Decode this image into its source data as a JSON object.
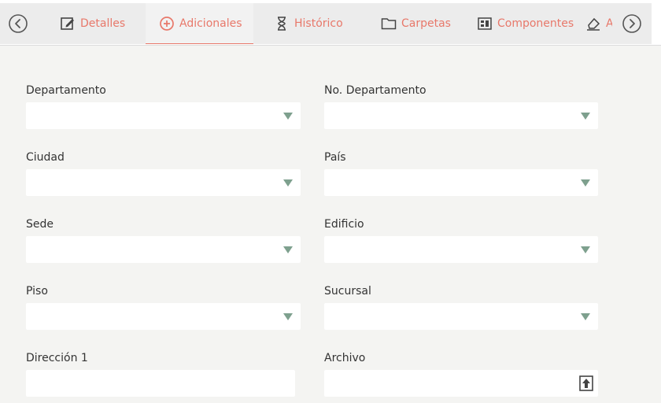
{
  "tabs": [
    {
      "label": "Detalles",
      "icon": "edit-icon"
    },
    {
      "label": "Adicionales",
      "icon": "plus-circle-icon"
    },
    {
      "label": "Histórico",
      "icon": "hourglass-icon"
    },
    {
      "label": "Carpetas",
      "icon": "folder-icon"
    },
    {
      "label": "Componentes",
      "icon": "components-icon"
    },
    {
      "label": "A",
      "icon": "eraser-icon"
    }
  ],
  "active_tab": "Adicionales",
  "colors": {
    "accent": "#e8786a",
    "caret": "#7ea08e"
  },
  "form": {
    "departamento": {
      "label": "Departamento",
      "value": ""
    },
    "no_departamento": {
      "label": "No. Departamento",
      "value": ""
    },
    "ciudad": {
      "label": "Ciudad",
      "value": ""
    },
    "pais": {
      "label": "País",
      "value": ""
    },
    "sede": {
      "label": "Sede",
      "value": ""
    },
    "edificio": {
      "label": "Edificio",
      "value": ""
    },
    "piso": {
      "label": "Piso",
      "value": ""
    },
    "sucursal": {
      "label": "Sucursal",
      "value": ""
    },
    "direccion1": {
      "label": "Dirección 1",
      "value": ""
    },
    "archivo": {
      "label": "Archivo",
      "value": ""
    }
  }
}
